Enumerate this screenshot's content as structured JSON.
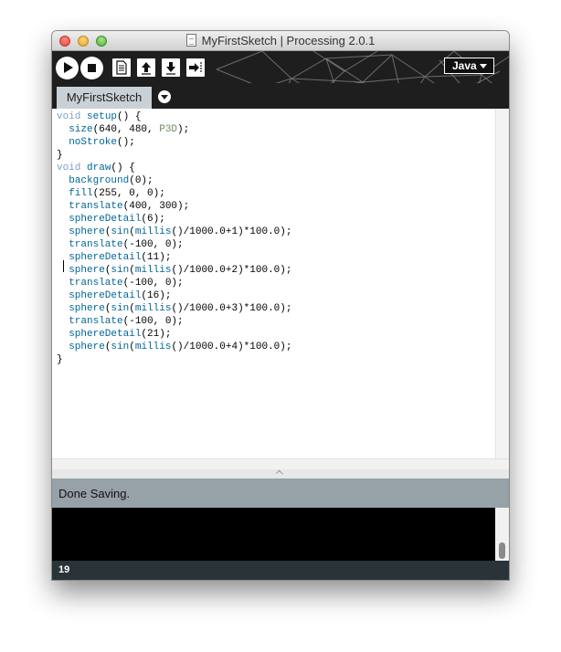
{
  "window": {
    "title": "MyFirstSketch | Processing 2.0.1"
  },
  "toolbar": {
    "run_icon": "run-icon",
    "stop_icon": "stop-icon",
    "new_icon": "new-sketch-icon",
    "open_icon": "open-icon",
    "save_icon": "save-icon",
    "export_icon": "export-icon",
    "mode_label": "Java"
  },
  "tabs": [
    {
      "label": "MyFirstSketch"
    }
  ],
  "colors": {
    "keyword": "#7fa1c3",
    "function": "#006699",
    "constant": "#718a62",
    "text": "#000000",
    "status_bg": "#96a1a8",
    "footer_bg": "#2a3338"
  },
  "editor": {
    "lines": [
      [
        [
          "void",
          "kw"
        ],
        [
          " ",
          "t"
        ],
        [
          "setup",
          "fn"
        ],
        [
          "() {",
          "t"
        ]
      ],
      [
        [
          "  ",
          "t"
        ],
        [
          "size",
          "fn"
        ],
        [
          "(640, 480, ",
          "t"
        ],
        [
          "P3D",
          "const"
        ],
        [
          ");",
          "t"
        ]
      ],
      [
        [
          "  ",
          "t"
        ],
        [
          "noStroke",
          "fn"
        ],
        [
          "();",
          "t"
        ]
      ],
      [
        [
          "}",
          "t"
        ]
      ],
      [
        [
          "void",
          "kw"
        ],
        [
          " ",
          "t"
        ],
        [
          "draw",
          "fn"
        ],
        [
          "() {",
          "t"
        ]
      ],
      [
        [
          "  ",
          "t"
        ],
        [
          "background",
          "fn"
        ],
        [
          "(0);",
          "t"
        ]
      ],
      [
        [
          "  ",
          "t"
        ],
        [
          "fill",
          "fn"
        ],
        [
          "(255, 0, 0);",
          "t"
        ]
      ],
      [
        [
          "  ",
          "t"
        ],
        [
          "translate",
          "fn"
        ],
        [
          "(400, 300);",
          "t"
        ]
      ],
      [
        [
          "  ",
          "t"
        ],
        [
          "sphereDetail",
          "fn"
        ],
        [
          "(6);",
          "t"
        ]
      ],
      [
        [
          "  ",
          "t"
        ],
        [
          "sphere",
          "fn"
        ],
        [
          "(",
          "t"
        ],
        [
          "sin",
          "fn"
        ],
        [
          "(",
          "t"
        ],
        [
          "millis",
          "fn"
        ],
        [
          "()/1000.0+1)*100.0);",
          "t"
        ]
      ],
      [
        [
          "  ",
          "t"
        ],
        [
          "translate",
          "fn"
        ],
        [
          "(-100, 0);",
          "t"
        ]
      ],
      [
        [
          "  ",
          "t"
        ],
        [
          "sphereDetail",
          "fn"
        ],
        [
          "(11);",
          "t"
        ]
      ],
      [
        [
          "  ",
          "t"
        ],
        [
          "sphere",
          "fn"
        ],
        [
          "(",
          "t"
        ],
        [
          "sin",
          "fn"
        ],
        [
          "(",
          "t"
        ],
        [
          "millis",
          "fn"
        ],
        [
          "()/1000.0+2)*100.0);",
          "t"
        ]
      ],
      [
        [
          "  ",
          "t"
        ],
        [
          "translate",
          "fn"
        ],
        [
          "(-100, 0);",
          "t"
        ]
      ],
      [
        [
          "  ",
          "t"
        ],
        [
          "sphereDetail",
          "fn"
        ],
        [
          "(16);",
          "t"
        ]
      ],
      [
        [
          "  ",
          "t"
        ],
        [
          "sphere",
          "fn"
        ],
        [
          "(",
          "t"
        ],
        [
          "sin",
          "fn"
        ],
        [
          "(",
          "t"
        ],
        [
          "millis",
          "fn"
        ],
        [
          "()/1000.0+3)*100.0);",
          "t"
        ]
      ],
      [
        [
          "  ",
          "t"
        ],
        [
          "translate",
          "fn"
        ],
        [
          "(-100, 0);",
          "t"
        ]
      ],
      [
        [
          "  ",
          "t"
        ],
        [
          "sphereDetail",
          "fn"
        ],
        [
          "(21);",
          "t"
        ]
      ],
      [
        [
          "  ",
          "t"
        ],
        [
          "sphere",
          "fn"
        ],
        [
          "(",
          "t"
        ],
        [
          "sin",
          "fn"
        ],
        [
          "(",
          "t"
        ],
        [
          "millis",
          "fn"
        ],
        [
          "()/1000.0+4)*100.0);",
          "t"
        ]
      ],
      [
        [
          "}",
          "t"
        ]
      ]
    ]
  },
  "status": {
    "message": "Done Saving."
  },
  "footer": {
    "line_number": "19"
  }
}
